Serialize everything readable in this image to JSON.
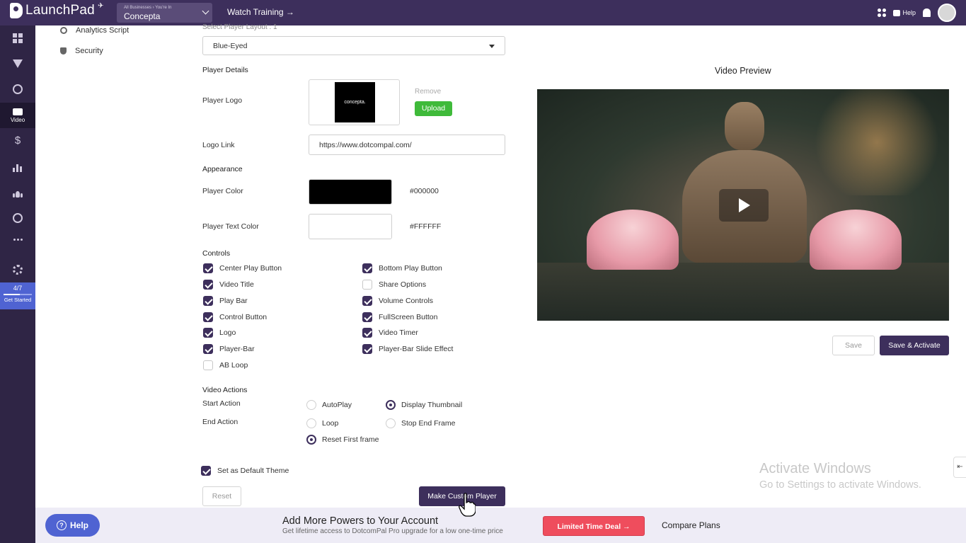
{
  "header": {
    "logo_text": "LaunchPad",
    "business_crumb": "All Businesses › You're In",
    "business_name": "Concepta",
    "watch_training": "Watch Training →",
    "help": "Help"
  },
  "sidebar": {
    "video_label": "Video",
    "get_started_count": "4/7",
    "get_started_progress": 0.57,
    "get_started_label": "Get Started"
  },
  "submenu": {
    "analytics": "Analytics Script",
    "security": "Security"
  },
  "form": {
    "layout_hint": "Select Player Layout : 1",
    "layout_value": "Blue-Eyed",
    "player_details": "Player Details",
    "player_logo_label": "Player Logo",
    "logo_text": "concepta.",
    "remove": "Remove",
    "upload": "Upload",
    "logo_link_label": "Logo Link",
    "logo_link_value": "https://www.dotcompal.com/",
    "appearance": "Appearance",
    "player_color_label": "Player Color",
    "player_color": "#000000",
    "player_text_color_label": "Player Text Color",
    "player_text_color": "#FFFFFF",
    "controls_label": "Controls",
    "controls_left": [
      {
        "label": "Center Play Button",
        "checked": true
      },
      {
        "label": "Video Title",
        "checked": true
      },
      {
        "label": "Play Bar",
        "checked": true
      },
      {
        "label": "Control Button",
        "checked": true
      },
      {
        "label": "Logo",
        "checked": true
      },
      {
        "label": "Player-Bar",
        "checked": true
      },
      {
        "label": "AB Loop",
        "checked": false
      }
    ],
    "controls_right": [
      {
        "label": "Bottom Play Button",
        "checked": true
      },
      {
        "label": "Share Options",
        "checked": false
      },
      {
        "label": "Volume Controls",
        "checked": true
      },
      {
        "label": "FullScreen Button",
        "checked": true
      },
      {
        "label": "Video Timer",
        "checked": true
      },
      {
        "label": "Player-Bar Slide Effect",
        "checked": true
      }
    ],
    "video_actions": "Video Actions",
    "start_action_label": "Start Action",
    "start_autoplay": "AutoPlay",
    "start_thumbnail": "Display Thumbnail",
    "end_action_label": "End Action",
    "end_loop": "Loop",
    "end_stop": "Stop End Frame",
    "end_reset": "Reset First frame",
    "default_theme": "Set as Default Theme",
    "reset": "Reset",
    "make_custom": "Make Custom Player"
  },
  "preview": {
    "title": "Video Preview",
    "save": "Save",
    "save_activate": "Save & Activate"
  },
  "watermark": {
    "line1": "Activate Windows",
    "line2": "Go to Settings to activate Windows."
  },
  "bottom": {
    "help": "Help",
    "promo_title": "Add More Powers to Your Account",
    "promo_sub": "Get lifetime access to DotcomPal Pro upgrade for a low one-time price",
    "deal": "Limited Time Deal →",
    "compare": "Compare Plans"
  },
  "colors": {
    "brand": "#3d2f5c",
    "upload": "#3fba3a",
    "deal": "#ef4d5d",
    "help_button": "#4f63d2"
  }
}
